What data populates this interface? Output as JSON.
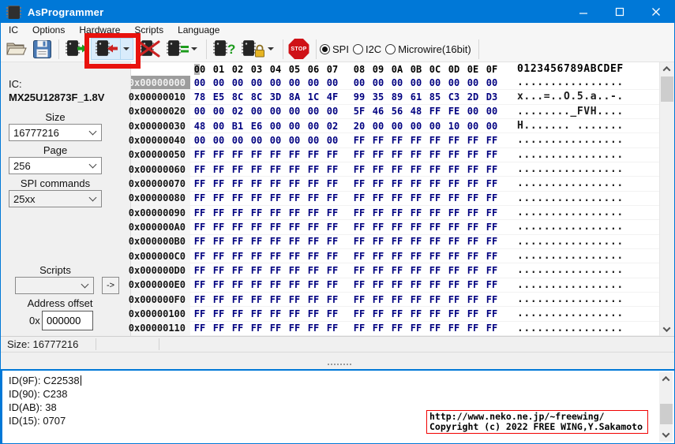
{
  "window": {
    "title": "AsProgrammer"
  },
  "menu": [
    "IC",
    "Options",
    "Hardware",
    "Scripts",
    "Language"
  ],
  "toolbar": {
    "stop_label": "STOP",
    "radios": [
      {
        "label": "SPI",
        "selected": true
      },
      {
        "label": "I2C",
        "selected": false
      },
      {
        "label": "Microwire(16bit)",
        "selected": false
      }
    ]
  },
  "sidebar": {
    "ic_label": "IC:",
    "ic_name": "MX25U12873F_1.8V",
    "size_label": "Size",
    "size_value": "16777216",
    "page_label": "Page",
    "page_value": "256",
    "spi_commands_label": "SPI commands",
    "spi_commands_value": "25xx",
    "scripts_label": "Scripts",
    "scripts_value": "",
    "run_button_label": "->",
    "offset_label": "Address offset",
    "offset_prefix": "0x",
    "offset_value": "000000"
  },
  "hex": {
    "col_headers": [
      "00",
      "01",
      "02",
      "03",
      "04",
      "05",
      "06",
      "07",
      "08",
      "09",
      "0A",
      "0B",
      "0C",
      "0D",
      "0E",
      "0F"
    ],
    "ascii_header": "0123456789ABCDEF",
    "rows": [
      {
        "addr": "0x00000000",
        "sel": true,
        "bytes": "00 00 00 00 00 00 00 00 00 00 00 00 00 00 00 00",
        "ascii": "................"
      },
      {
        "addr": "0x00000010",
        "sel": false,
        "bytes": "78 E5 8C 8C 3D 8A 1C 4F 99 35 89 61 85 C3 2D D3",
        "ascii": "x...=..O.5.a..-."
      },
      {
        "addr": "0x00000020",
        "sel": false,
        "bytes": "00 00 02 00 00 00 00 00 5F 46 56 48 FF FE 00 00",
        "ascii": "........_FVH...."
      },
      {
        "addr": "0x00000030",
        "sel": false,
        "bytes": "48 00 B1 E6 00 00 00 02 20 00 00 00 00 10 00 00",
        "ascii": "H....... ......."
      },
      {
        "addr": "0x00000040",
        "sel": false,
        "bytes": "00 00 00 00 00 00 00 00 FF FF FF FF FF FF FF FF",
        "ascii": "................"
      },
      {
        "addr": "0x00000050",
        "sel": false,
        "bytes": "FF FF FF FF FF FF FF FF FF FF FF FF FF FF FF FF",
        "ascii": "................"
      },
      {
        "addr": "0x00000060",
        "sel": false,
        "bytes": "FF FF FF FF FF FF FF FF FF FF FF FF FF FF FF FF",
        "ascii": "................"
      },
      {
        "addr": "0x00000070",
        "sel": false,
        "bytes": "FF FF FF FF FF FF FF FF FF FF FF FF FF FF FF FF",
        "ascii": "................"
      },
      {
        "addr": "0x00000080",
        "sel": false,
        "bytes": "FF FF FF FF FF FF FF FF FF FF FF FF FF FF FF FF",
        "ascii": "................"
      },
      {
        "addr": "0x00000090",
        "sel": false,
        "bytes": "FF FF FF FF FF FF FF FF FF FF FF FF FF FF FF FF",
        "ascii": "................"
      },
      {
        "addr": "0x000000A0",
        "sel": false,
        "bytes": "FF FF FF FF FF FF FF FF FF FF FF FF FF FF FF FF",
        "ascii": "................"
      },
      {
        "addr": "0x000000B0",
        "sel": false,
        "bytes": "FF FF FF FF FF FF FF FF FF FF FF FF FF FF FF FF",
        "ascii": "................"
      },
      {
        "addr": "0x000000C0",
        "sel": false,
        "bytes": "FF FF FF FF FF FF FF FF FF FF FF FF FF FF FF FF",
        "ascii": "................"
      },
      {
        "addr": "0x000000D0",
        "sel": false,
        "bytes": "FF FF FF FF FF FF FF FF FF FF FF FF FF FF FF FF",
        "ascii": "................"
      },
      {
        "addr": "0x000000E0",
        "sel": false,
        "bytes": "FF FF FF FF FF FF FF FF FF FF FF FF FF FF FF FF",
        "ascii": "................"
      },
      {
        "addr": "0x000000F0",
        "sel": false,
        "bytes": "FF FF FF FF FF FF FF FF FF FF FF FF FF FF FF FF",
        "ascii": "................"
      },
      {
        "addr": "0x00000100",
        "sel": false,
        "bytes": "FF FF FF FF FF FF FF FF FF FF FF FF FF FF FF FF",
        "ascii": "................"
      },
      {
        "addr": "0x00000110",
        "sel": false,
        "bytes": "FF FF FF FF FF FF FF FF FF FF FF FF FF FF FF FF",
        "ascii": "................"
      }
    ]
  },
  "status": {
    "size_text": "Size: 16777216"
  },
  "log": {
    "lines": [
      "ID(9F): C22538",
      "ID(90): C238",
      "ID(AB): 38",
      "ID(15): 0707"
    ]
  },
  "annotation": {
    "line1": "http://www.neko.ne.jp/~freewing/",
    "line2": "Copyright (c) 2022 FREE WING,Y.Sakamoto"
  },
  "colors": {
    "accent": "#0078d7",
    "hex-byte": "#000080",
    "annotation-red": "#e8120d",
    "stop-red": "#cf1217"
  }
}
